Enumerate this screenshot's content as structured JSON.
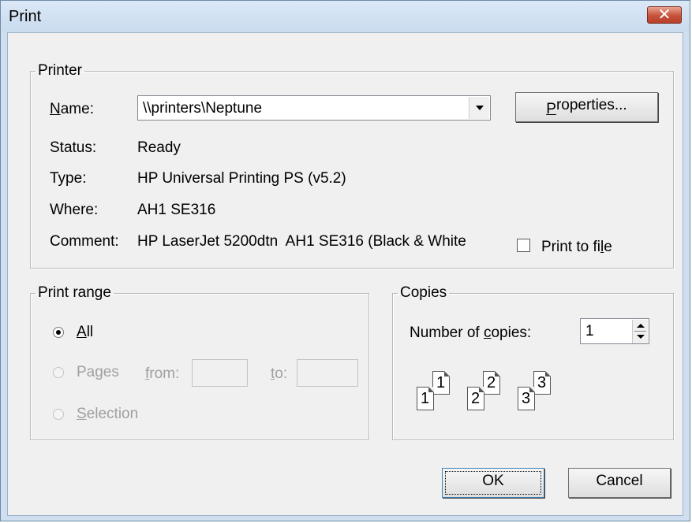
{
  "window": {
    "title": "Print"
  },
  "printer": {
    "group_label": "Printer",
    "name_label": "Name:",
    "name_value": "\\\\printers\\Neptune",
    "properties_label": "Properties...",
    "status_label": "Status:",
    "status_value": "Ready",
    "type_label": "Type:",
    "type_value": "HP Universal Printing PS (v5.2)",
    "where_label": "Where:",
    "where_value": "AH1 SE316",
    "comment_label": "Comment:",
    "comment_value": "HP LaserJet 5200dtn  AH1 SE316 (Black & White",
    "print_to_file_label": "Print to file",
    "print_to_file_checked": false
  },
  "print_range": {
    "group_label": "Print range",
    "all_label": "All",
    "pages_label": "Pages",
    "from_label": "from:",
    "to_label": "to:",
    "from_value": "",
    "to_value": "",
    "selection_label": "Selection",
    "selected": "All"
  },
  "copies": {
    "group_label": "Copies",
    "number_label": "Number of copies:",
    "number_value": "1",
    "collate_icons": [
      "1",
      "1",
      "2",
      "2",
      "3",
      "3"
    ]
  },
  "buttons": {
    "ok_label": "OK",
    "cancel_label": "Cancel"
  }
}
